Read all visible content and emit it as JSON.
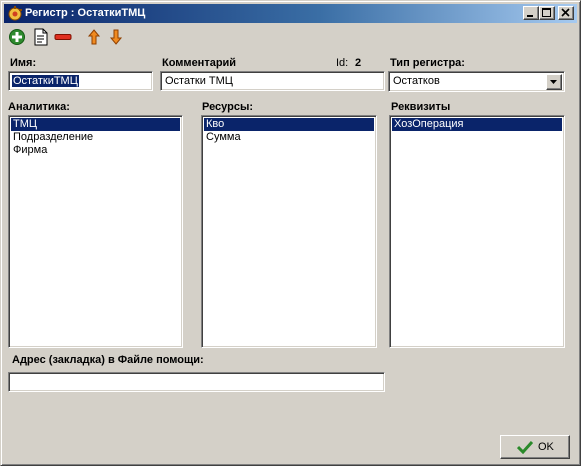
{
  "window": {
    "title": "Регистр : ОстаткиТМЦ"
  },
  "toolbar": {
    "add_icon": "add-icon",
    "edit_icon": "edit-document-icon",
    "delete_icon": "delete-icon",
    "move_up_icon": "arrow-up-icon",
    "move_down_icon": "arrow-down-icon"
  },
  "form": {
    "name_label": "Имя:",
    "name_value": "ОстаткиТМЦ",
    "comment_label": "Комментарий",
    "comment_value": "Остатки ТМЦ",
    "id_label": "Id:",
    "id_value": "2",
    "type_label": "Тип регистра:",
    "type_value": "Остатков",
    "analytics_label": "Аналитика:",
    "analytics_items": [
      "ТМЦ",
      "Подразделение",
      "Фирма"
    ],
    "resources_label": "Ресурсы:",
    "resources_items": [
      "Кво",
      "Сумма"
    ],
    "requisites_label": "Реквизиты",
    "requisites_items": [
      "ХозОперация"
    ],
    "help_label": "Адрес (закладка) в Файле помощи:",
    "help_value": ""
  },
  "buttons": {
    "ok_label": "OK"
  },
  "colors": {
    "selection": "#0a246a",
    "face": "#d4d0c8",
    "title_start": "#0a246a",
    "title_end": "#a6caf0"
  }
}
